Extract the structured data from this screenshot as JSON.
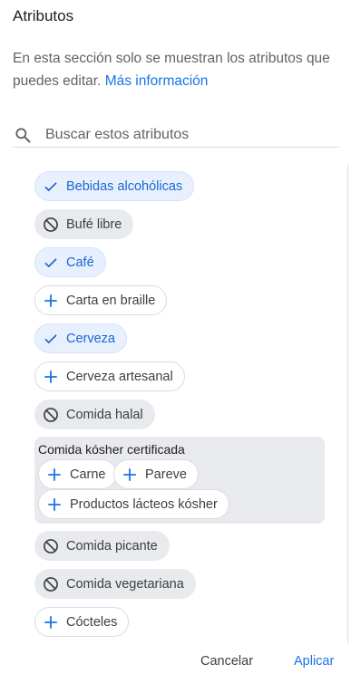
{
  "header": {
    "title": "Atributos",
    "description": "En esta sección solo se muestran los atributos que puedes editar.",
    "more_link": "Más información"
  },
  "search": {
    "placeholder": "Buscar estos atributos",
    "value": ""
  },
  "attributes": [
    {
      "label": "Bebidas alcohólicas",
      "state": "selected",
      "icon": "check-icon"
    },
    {
      "label": "Bufé libre",
      "state": "excluded",
      "icon": "block-icon"
    },
    {
      "label": "Café",
      "state": "selected",
      "icon": "check-icon"
    },
    {
      "label": "Carta en braille",
      "state": "unset",
      "icon": "plus-icon"
    },
    {
      "label": "Cerveza",
      "state": "selected",
      "icon": "check-icon"
    },
    {
      "label": "Cerveza artesanal",
      "state": "unset",
      "icon": "plus-icon"
    },
    {
      "label": "Comida halal",
      "state": "excluded",
      "icon": "block-icon"
    }
  ],
  "group": {
    "label": "Comida kósher certificada",
    "options": [
      {
        "label": "Carne",
        "icon": "plus-icon"
      },
      {
        "label": "Pareve",
        "icon": "plus-icon"
      },
      {
        "label": "Productos lácteos kósher",
        "icon": "plus-icon"
      }
    ]
  },
  "attributes_after": [
    {
      "label": "Comida picante",
      "state": "excluded",
      "icon": "block-icon"
    },
    {
      "label": "Comida vegetariana",
      "state": "excluded",
      "icon": "block-icon"
    },
    {
      "label": "Cócteles",
      "state": "unset",
      "icon": "plus-icon"
    }
  ],
  "footer": {
    "cancel_label": "Cancelar",
    "apply_label": "Aplicar"
  },
  "colors": {
    "accent": "#1a73e8",
    "selected_bg": "#e8f0fe",
    "excluded_bg": "#e8eaed"
  }
}
